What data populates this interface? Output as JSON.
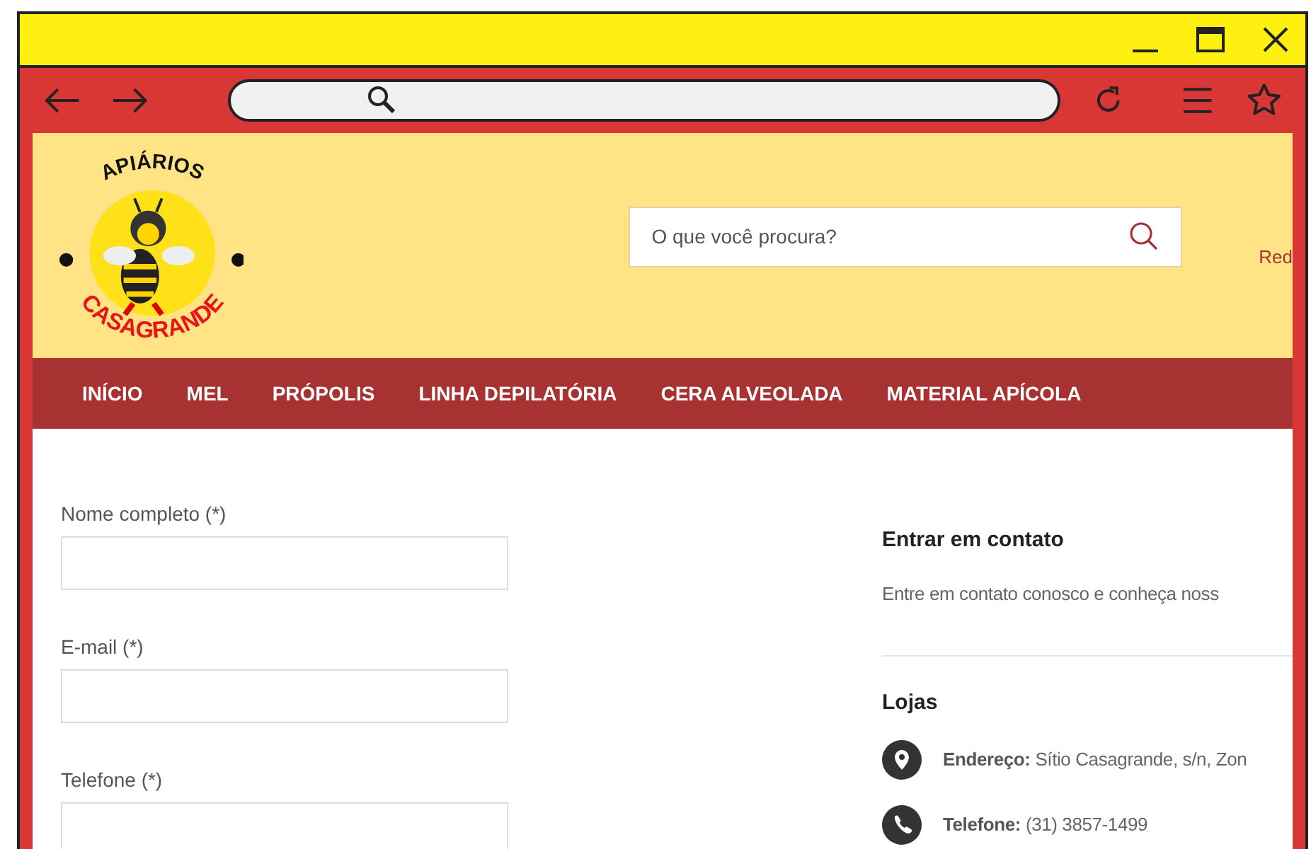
{
  "logo": {
    "top_text": "APIÁRIOS",
    "bottom_text": "CASAGRANDE"
  },
  "search": {
    "placeholder": "O que você procura?"
  },
  "header_link": "Red",
  "nav": [
    {
      "label": "INÍCIO"
    },
    {
      "label": "MEL"
    },
    {
      "label": "PRÓPOLIS"
    },
    {
      "label": "LINHA DEPILATÓRIA"
    },
    {
      "label": "CERA ALVEOLADA"
    },
    {
      "label": "MATERIAL APÍCOLA"
    }
  ],
  "form": {
    "fields": [
      {
        "label": "Nome completo (*)"
      },
      {
        "label": "E-mail (*)"
      },
      {
        "label": "Telefone (*)"
      }
    ]
  },
  "contact": {
    "title": "Entrar em contato",
    "text": "Entre em contato conosco e conheça noss"
  },
  "stores": {
    "title": "Lojas",
    "items": [
      {
        "kind": "address",
        "text": "**Endereço:** Sítio Casagrande, s/n, Zon"
      },
      {
        "kind": "phone",
        "text": "**Telefone:** (31) 3857-1499"
      }
    ]
  }
}
